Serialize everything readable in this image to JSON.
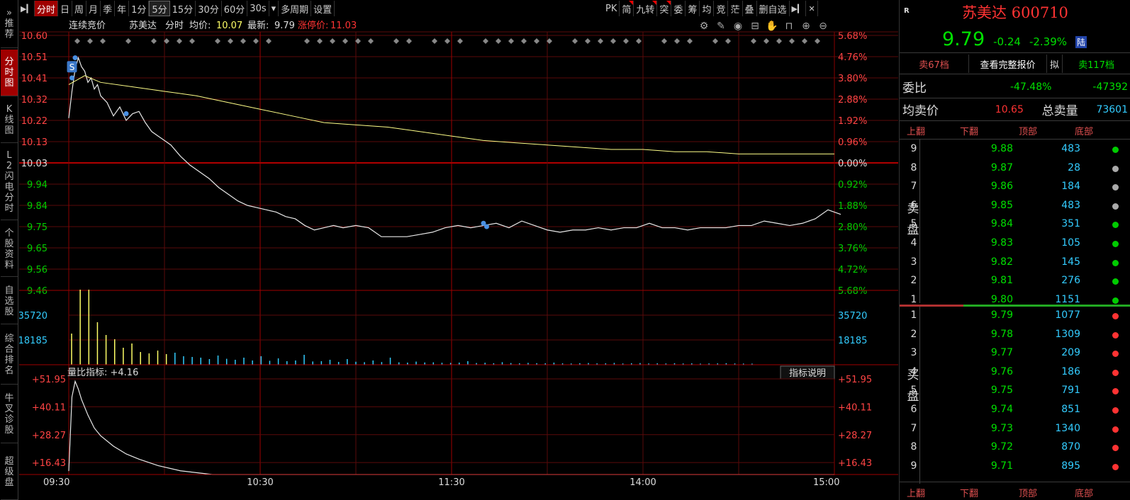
{
  "left_nav": {
    "items": [
      {
        "label": "»推荐",
        "active": false
      },
      {
        "label": "分时图",
        "active": true
      },
      {
        "label": "K线图",
        "active": false
      },
      {
        "label": "L2闪电分时",
        "active": false
      },
      {
        "label": "个股资料",
        "active": false
      },
      {
        "label": "自选股",
        "active": false
      },
      {
        "label": "综合排名",
        "active": false
      },
      {
        "label": "牛叉诊股",
        "active": false
      },
      {
        "label": "超级盘",
        "active": false
      }
    ]
  },
  "toolbar": {
    "items": [
      "分时",
      "日",
      "周",
      "月",
      "季",
      "年",
      "1分",
      "5分",
      "15分",
      "30分",
      "60分",
      "30s",
      "多周期",
      "设置"
    ],
    "active": "分时",
    "selected": "5分",
    "dropdown_after": "30s",
    "right_items": [
      "PK",
      "简",
      "九转",
      "突",
      "委",
      "筹",
      "均",
      "竞",
      "茫",
      "叠",
      "删自选"
    ],
    "flagged": [
      "简",
      "九转",
      "突"
    ]
  },
  "chart_header": {
    "mode": "连续竞价",
    "name": "苏美达",
    "view": "分时",
    "avg_label": "均价:",
    "avg_value": "10.07",
    "last_label": "最新:",
    "last_value": "9.79",
    "limit_label": "涨停价:",
    "limit_value": "11.03"
  },
  "chart_icons": [
    "gear-icon",
    "brush-icon",
    "eye-icon",
    "basket-icon",
    "hand-icon",
    "lock-icon",
    "zoom-in-icon",
    "zoom-out-icon"
  ],
  "chart_data": [
    {
      "type": "line",
      "name": "price",
      "y_ticks_left": [
        "10.60",
        "10.51",
        "10.41",
        "10.32",
        "10.22",
        "10.13",
        "10.03",
        "9.94",
        "9.84",
        "9.75",
        "9.65",
        "9.56",
        "9.46"
      ],
      "y_ticks_right": [
        "5.68%",
        "4.76%",
        "3.80%",
        "2.88%",
        "1.92%",
        "0.96%",
        "0.00%",
        "0.92%",
        "1.88%",
        "2.80%",
        "3.76%",
        "4.72%",
        "5.68%"
      ],
      "base": 10.03,
      "ylim": [
        9.46,
        10.6
      ],
      "x_ticks": [
        "09:30",
        "10:30",
        "11:30",
        "14:00",
        "15:00"
      ],
      "series": [
        {
          "x": [
            0,
            1,
            2,
            3,
            4,
            5,
            6,
            7,
            8,
            9,
            10,
            12,
            14,
            16,
            18,
            20,
            22,
            24,
            26,
            28,
            30,
            32,
            35,
            38,
            41,
            44,
            47,
            50,
            53,
            56,
            59,
            62,
            65,
            68,
            71,
            74,
            77,
            80,
            83,
            86,
            90,
            94,
            98,
            102,
            106,
            110,
            114,
            118,
            122,
            126,
            130,
            134,
            138,
            142,
            146,
            150,
            154,
            158,
            162,
            166,
            170,
            174,
            178,
            182,
            186,
            190,
            194,
            198,
            202,
            206,
            210,
            214,
            218,
            222,
            226,
            230,
            234,
            238,
            242,
            236
          ],
          "y": [
            10.23,
            10.35,
            10.45,
            10.5,
            10.46,
            10.44,
            10.39,
            10.41,
            10.36,
            10.38,
            10.33,
            10.3,
            10.24,
            10.28,
            10.22,
            10.25,
            10.26,
            10.21,
            10.17,
            10.15,
            10.13,
            10.11,
            10.06,
            10.02,
            9.99,
            9.96,
            9.92,
            9.89,
            9.86,
            9.84,
            9.83,
            9.82,
            9.81,
            9.79,
            9.78,
            9.75,
            9.73,
            9.74,
            9.75,
            9.74,
            9.75,
            9.74,
            9.7,
            9.7,
            9.7,
            9.71,
            9.72,
            9.74,
            9.75,
            9.74,
            9.75,
            9.76,
            9.74,
            9.77,
            9.75,
            9.73,
            9.72,
            9.73,
            9.73,
            9.74,
            9.73,
            9.74,
            9.74,
            9.76,
            9.74,
            9.74,
            9.73,
            9.74,
            9.74,
            9.74,
            9.75,
            9.75,
            9.77,
            9.76,
            9.75,
            9.76,
            9.78,
            9.82,
            9.8,
            9.8
          ]
        },
        {
          "x": [
            0,
            5,
            10,
            20,
            30,
            40,
            50,
            60,
            70,
            80,
            90,
            100,
            110,
            120,
            130,
            140,
            150,
            160,
            170,
            180,
            190,
            200,
            210,
            220,
            230,
            240
          ],
          "y": [
            10.38,
            10.42,
            10.39,
            10.37,
            10.35,
            10.33,
            10.3,
            10.27,
            10.24,
            10.21,
            10.2,
            10.19,
            10.17,
            10.15,
            10.13,
            10.12,
            10.11,
            10.1,
            10.09,
            10.09,
            10.08,
            10.08,
            10.07,
            10.07,
            10.07,
            10.07
          ]
        }
      ]
    },
    {
      "type": "bar",
      "name": "volume",
      "y_ticks": [
        "35720",
        "18185"
      ],
      "ylim": [
        0,
        50000
      ],
      "values": [
        22000,
        53000,
        53000,
        30000,
        21000,
        18000,
        12000,
        15000,
        9000,
        8000,
        10000,
        7500,
        8500,
        6000,
        5500,
        5000,
        4000,
        6500,
        4200,
        3500,
        5000,
        3000,
        6000,
        2800,
        4500,
        2500,
        3000,
        7000,
        2300,
        2500,
        3500,
        2000,
        4000,
        2100,
        1800,
        3000,
        1900,
        5000,
        1700,
        1500,
        2200,
        1600,
        1700,
        1400,
        1300,
        1500,
        2500,
        1200,
        1400,
        1100,
        1800,
        1200,
        1000,
        1300,
        1100,
        1000,
        1500,
        1000,
        900,
        1100,
        1200,
        950,
        1000,
        1300,
        900,
        1100,
        1200,
        900,
        1000,
        900,
        1100,
        900,
        1000,
        800,
        900,
        950,
        1100,
        900,
        850,
        800
      ]
    },
    {
      "type": "line",
      "name": "量比",
      "indicator_label": "量比指标: +4.16",
      "indicator_button": "指标说明",
      "y_ticks": [
        "+51.95",
        "+40.11",
        "+28.27",
        "+16.43"
      ],
      "ylim": [
        4.16,
        51.95
      ],
      "x": [
        0,
        1,
        2,
        3,
        4,
        6,
        8,
        10,
        14,
        18,
        22,
        28,
        35,
        45,
        55,
        65,
        80,
        100,
        120,
        140,
        160,
        180,
        200,
        220,
        240
      ],
      "y": [
        16.4,
        45,
        51,
        48,
        44,
        38,
        33,
        30,
        26,
        23,
        21,
        18.5,
        16.5,
        14,
        12,
        10.5,
        9,
        7.5,
        6.6,
        5.9,
        5.4,
        5.0,
        4.7,
        4.4,
        4.2
      ]
    }
  ],
  "panel": {
    "badge": "R",
    "name": "苏美达",
    "code": "600710",
    "price": "9.79",
    "change": "-0.24",
    "change_pct": "-2.39%",
    "market_tag": "陆",
    "tabs": [
      "卖67档",
      "查看完整报价",
      "拟",
      "卖117档"
    ],
    "weibi_label": "委比",
    "weibi_pct": "-47.48%",
    "weibi_val": "-47392",
    "avg_sell_label": "均卖价",
    "avg_sell_price": "10.65",
    "total_sell_label": "总卖量",
    "total_sell_vol": "73601",
    "headers": [
      "上翻",
      "下翻",
      "顶部",
      "底部"
    ],
    "sell_label": "卖盘",
    "buy_label": "买盘",
    "sell_book": [
      {
        "lvl": "9",
        "price": "9.88",
        "vol": "483"
      },
      {
        "lvl": "8",
        "price": "9.87",
        "vol": "28"
      },
      {
        "lvl": "7",
        "price": "9.86",
        "vol": "184"
      },
      {
        "lvl": "6",
        "price": "9.85",
        "vol": "483"
      },
      {
        "lvl": "5",
        "price": "9.84",
        "vol": "351"
      },
      {
        "lvl": "4",
        "price": "9.83",
        "vol": "105"
      },
      {
        "lvl": "3",
        "price": "9.82",
        "vol": "145"
      },
      {
        "lvl": "2",
        "price": "9.81",
        "vol": "276"
      },
      {
        "lvl": "1",
        "price": "9.80",
        "vol": "1151"
      }
    ],
    "buy_book": [
      {
        "lvl": "1",
        "price": "9.79",
        "vol": "1077"
      },
      {
        "lvl": "2",
        "price": "9.78",
        "vol": "1309"
      },
      {
        "lvl": "3",
        "price": "9.77",
        "vol": "209"
      },
      {
        "lvl": "4",
        "price": "9.76",
        "vol": "186"
      },
      {
        "lvl": "5",
        "price": "9.75",
        "vol": "791"
      },
      {
        "lvl": "6",
        "price": "9.74",
        "vol": "851"
      },
      {
        "lvl": "7",
        "price": "9.73",
        "vol": "1340"
      },
      {
        "lvl": "8",
        "price": "9.72",
        "vol": "870"
      },
      {
        "lvl": "9",
        "price": "9.71",
        "vol": "895"
      }
    ],
    "colors": {
      "up": "#ff3333",
      "down": "#00e000",
      "vol": "#33ccff",
      "sell_dot_green": "#00cc00",
      "sell_dot_gray": "#aaaaaa",
      "buy_dot": "#ff3333"
    }
  }
}
